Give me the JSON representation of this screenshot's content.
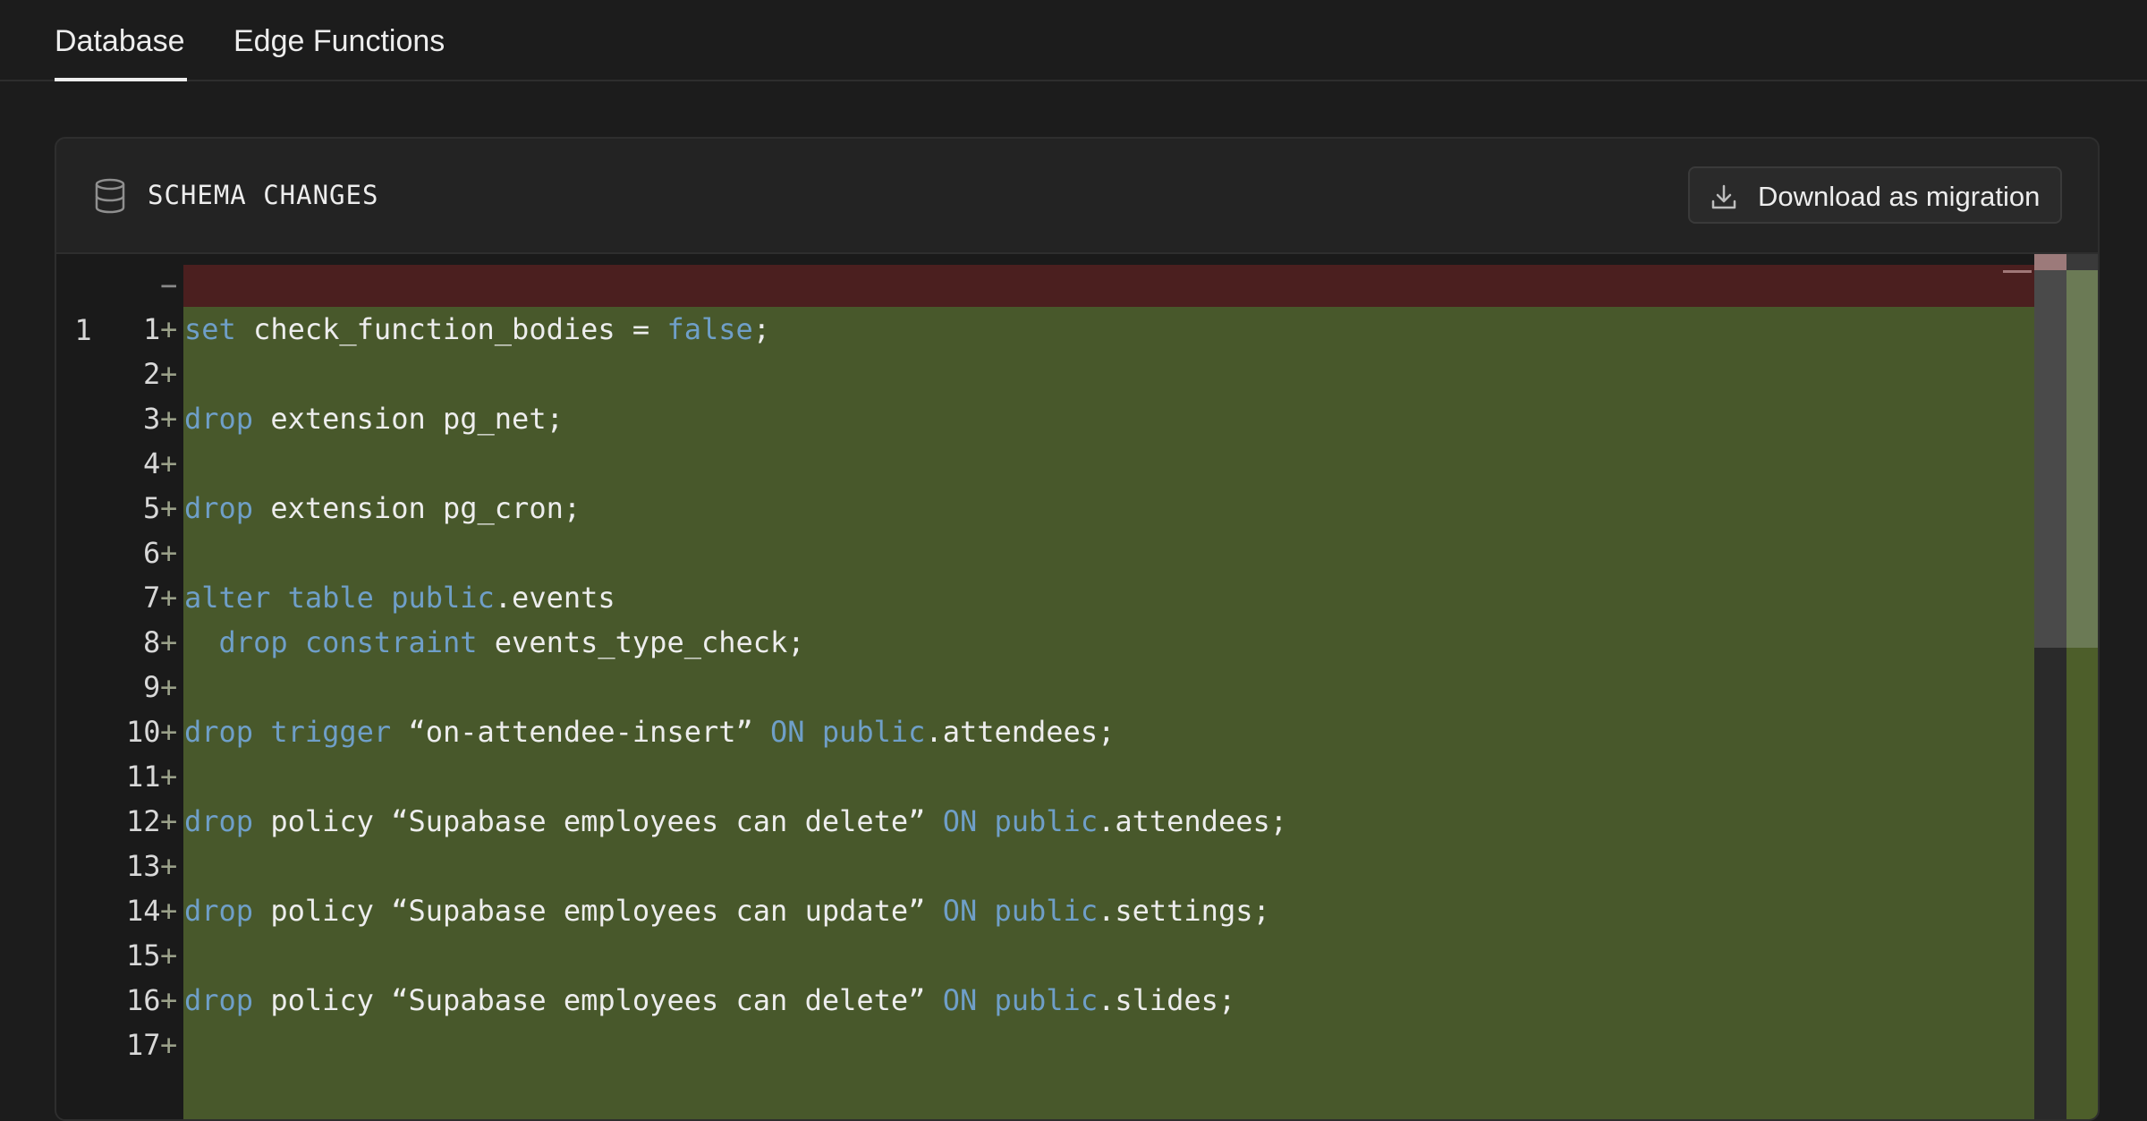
{
  "tabs": [
    {
      "label": "Database",
      "active": true
    },
    {
      "label": "Edge Functions",
      "active": false
    }
  ],
  "panel": {
    "title": "SCHEMA CHANGES",
    "icon": "database-icon",
    "download_button": {
      "label": "Download as migration",
      "icon": "download-icon"
    }
  },
  "diff": {
    "removed_line_number": "1",
    "removed_marker": "−",
    "added_marker": "+",
    "lines": [
      {
        "n": "1",
        "code": [
          {
            "t": "set",
            "k": true
          },
          {
            "t": " check_function_bodies = "
          },
          {
            "t": "false",
            "k": true
          },
          {
            "t": ";"
          }
        ]
      },
      {
        "n": "2",
        "code": []
      },
      {
        "n": "3",
        "code": [
          {
            "t": "drop",
            "k": true
          },
          {
            "t": " extension pg_net;"
          }
        ]
      },
      {
        "n": "4",
        "code": []
      },
      {
        "n": "5",
        "code": [
          {
            "t": "drop",
            "k": true
          },
          {
            "t": " extension pg_cron;"
          }
        ]
      },
      {
        "n": "6",
        "code": []
      },
      {
        "n": "7",
        "code": [
          {
            "t": "alter table public",
            "k": true
          },
          {
            "t": ".events"
          }
        ]
      },
      {
        "n": "8",
        "code": [
          {
            "t": "  "
          },
          {
            "t": "drop constraint",
            "k": true
          },
          {
            "t": " events_type_check;"
          }
        ]
      },
      {
        "n": "9",
        "code": []
      },
      {
        "n": "10",
        "code": [
          {
            "t": "drop trigger",
            "k": true
          },
          {
            "t": " “on-attendee-insert” "
          },
          {
            "t": "ON public",
            "k": true
          },
          {
            "t": ".attendees;"
          }
        ]
      },
      {
        "n": "11",
        "code": []
      },
      {
        "n": "12",
        "code": [
          {
            "t": "drop",
            "k": true
          },
          {
            "t": " policy “Supabase employees can delete” "
          },
          {
            "t": "ON public",
            "k": true
          },
          {
            "t": ".attendees;"
          }
        ]
      },
      {
        "n": "13",
        "code": []
      },
      {
        "n": "14",
        "code": [
          {
            "t": "drop",
            "k": true
          },
          {
            "t": " policy “Supabase employees can update” "
          },
          {
            "t": "ON public",
            "k": true
          },
          {
            "t": ".settings;"
          }
        ]
      },
      {
        "n": "15",
        "code": []
      },
      {
        "n": "16",
        "code": [
          {
            "t": "drop",
            "k": true
          },
          {
            "t": " policy “Supabase employees can delete” "
          },
          {
            "t": "ON public",
            "k": true
          },
          {
            "t": ".slides;"
          }
        ]
      },
      {
        "n": "17",
        "code": []
      }
    ]
  },
  "colors": {
    "background": "#1c1c1c",
    "removed_line": "#4b1f1f",
    "added_line": "#48582b",
    "keyword": "#6f9fc8"
  }
}
